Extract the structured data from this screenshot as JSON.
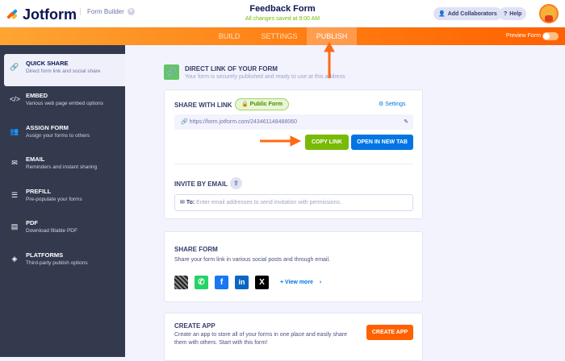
{
  "header": {
    "brand": "Jotform",
    "builder": "Form Builder",
    "title": "Feedback Form",
    "saved": "All changes saved at 9:00 AM",
    "add_collaborators": "Add Collaborators",
    "help": "Help"
  },
  "nav": {
    "tabs": [
      "BUILD",
      "SETTINGS",
      "PUBLISH"
    ],
    "active": "PUBLISH",
    "preview": "Preview Form"
  },
  "sidebar": {
    "items": [
      {
        "title": "QUICK SHARE",
        "desc": "Direct form link and social share",
        "icon": "link-icon"
      },
      {
        "title": "EMBED",
        "desc": "Various web page embed options",
        "icon": "code-icon"
      },
      {
        "title": "ASSIGN FORM",
        "desc": "Assign your forms to others",
        "icon": "users-icon"
      },
      {
        "title": "EMAIL",
        "desc": "Reminders and instant sharing",
        "icon": "envelope-icon"
      },
      {
        "title": "PREFILL",
        "desc": "Pre-populate your forms",
        "icon": "prefill-icon"
      },
      {
        "title": "PDF",
        "desc": "Download fillable PDF",
        "icon": "pdf-icon"
      },
      {
        "title": "PLATFORMS",
        "desc": "Third-party publish options",
        "icon": "layers-icon"
      }
    ]
  },
  "direct": {
    "title": "DIRECT LINK OF YOUR FORM",
    "desc": "Your form is securely published and ready to use at this address"
  },
  "share_link": {
    "title": "SHARE WITH LINK",
    "badge": "Public Form",
    "settings": "Settings",
    "url": "https://form.jotform.com/243461148488060",
    "copy": "COPY LINK",
    "open": "OPEN IN NEW TAB"
  },
  "invite": {
    "title": "INVITE BY EMAIL",
    "to": "To:",
    "placeholder": "Enter email addresses to send invitation with permissions."
  },
  "share_form": {
    "title": "SHARE FORM",
    "desc": "Share your form link in various social posts and through email.",
    "view_more": "View more"
  },
  "create_app": {
    "title": "CREATE APP",
    "desc": "Create an app to store all of your forms in one place and easily share them with others. Start with this form!",
    "button": "CREATE APP"
  },
  "colors": {
    "orange": "#ff6100",
    "green": "#78bb07",
    "blue": "#0075e3",
    "sidebar": "#343a4e"
  }
}
